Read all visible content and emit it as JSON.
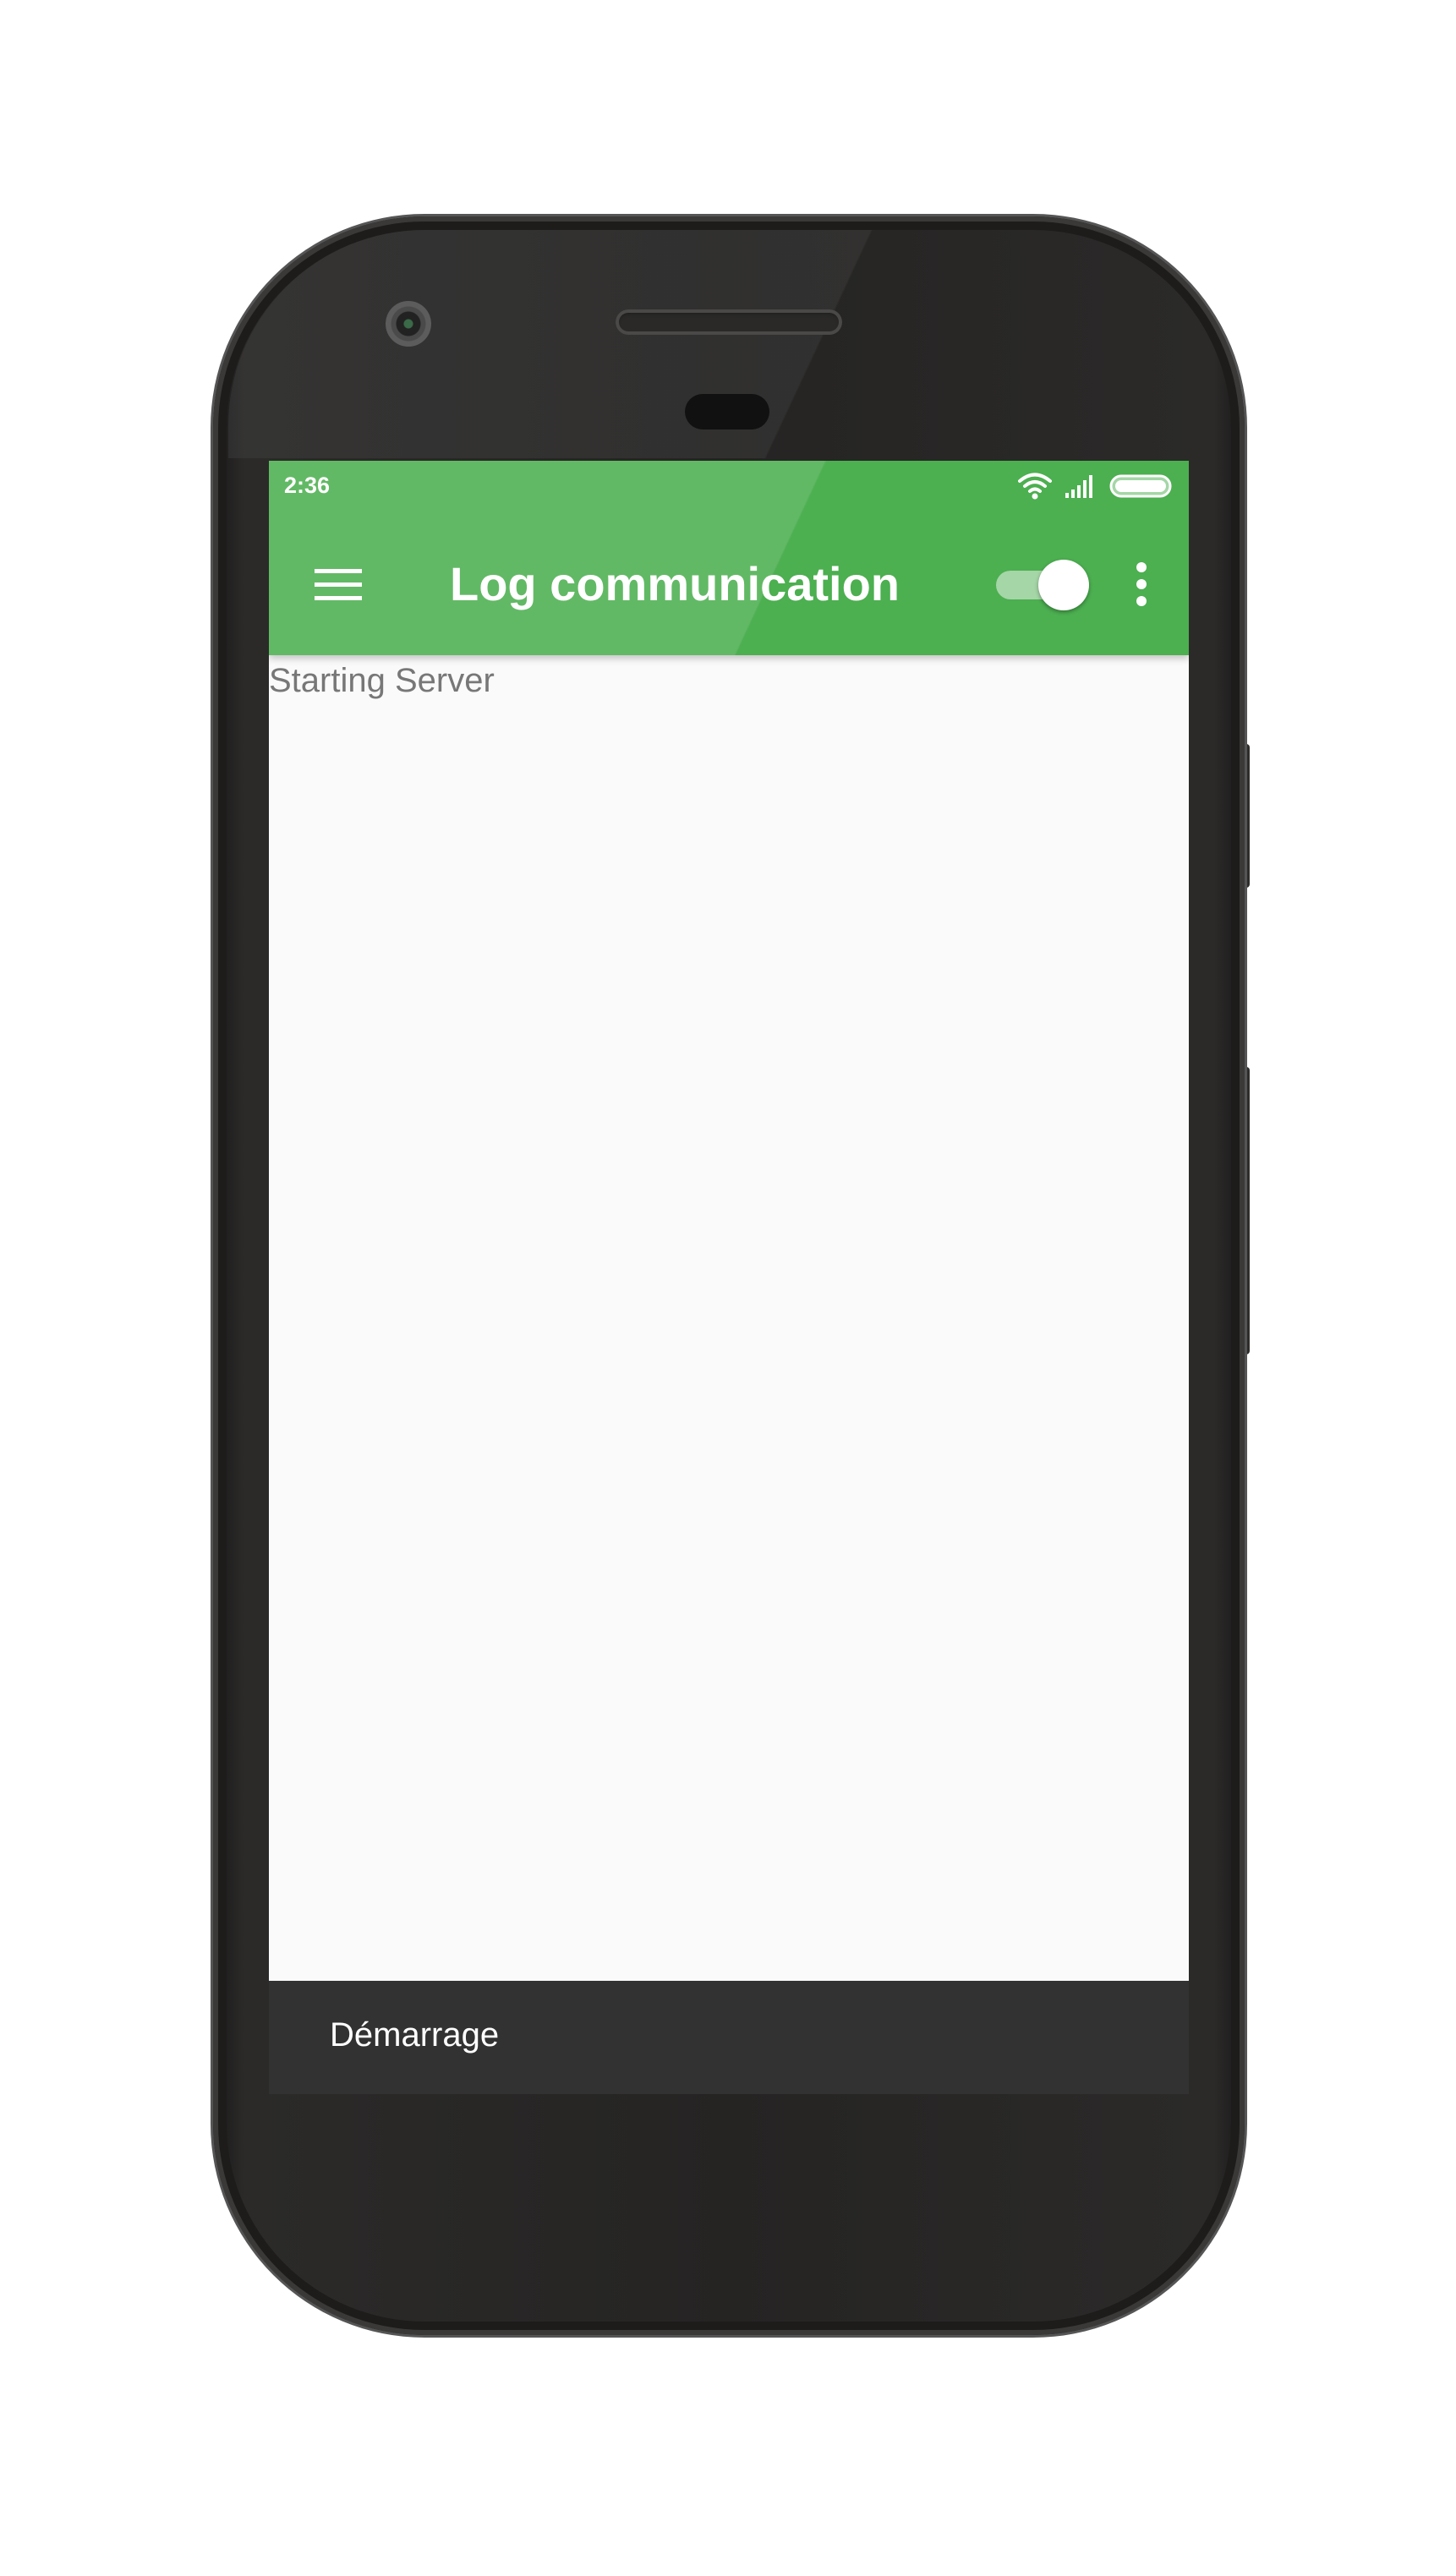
{
  "status_bar": {
    "time": "2:36",
    "icons": [
      "wifi-icon",
      "signal-icon",
      "battery-icon"
    ]
  },
  "toolbar": {
    "menu_icon": "hamburger-menu-icon",
    "title": "Log communication",
    "toggle_state": "on",
    "overflow_icon": "more-vert-icon"
  },
  "log": {
    "lines": [
      "Starting Server"
    ]
  },
  "snackbar": {
    "message": "Démarrage"
  },
  "colors": {
    "primary": "#4caf50",
    "toggle_track": "#a5d6a7",
    "background": "#fafafa",
    "snackbar": "#323232"
  }
}
